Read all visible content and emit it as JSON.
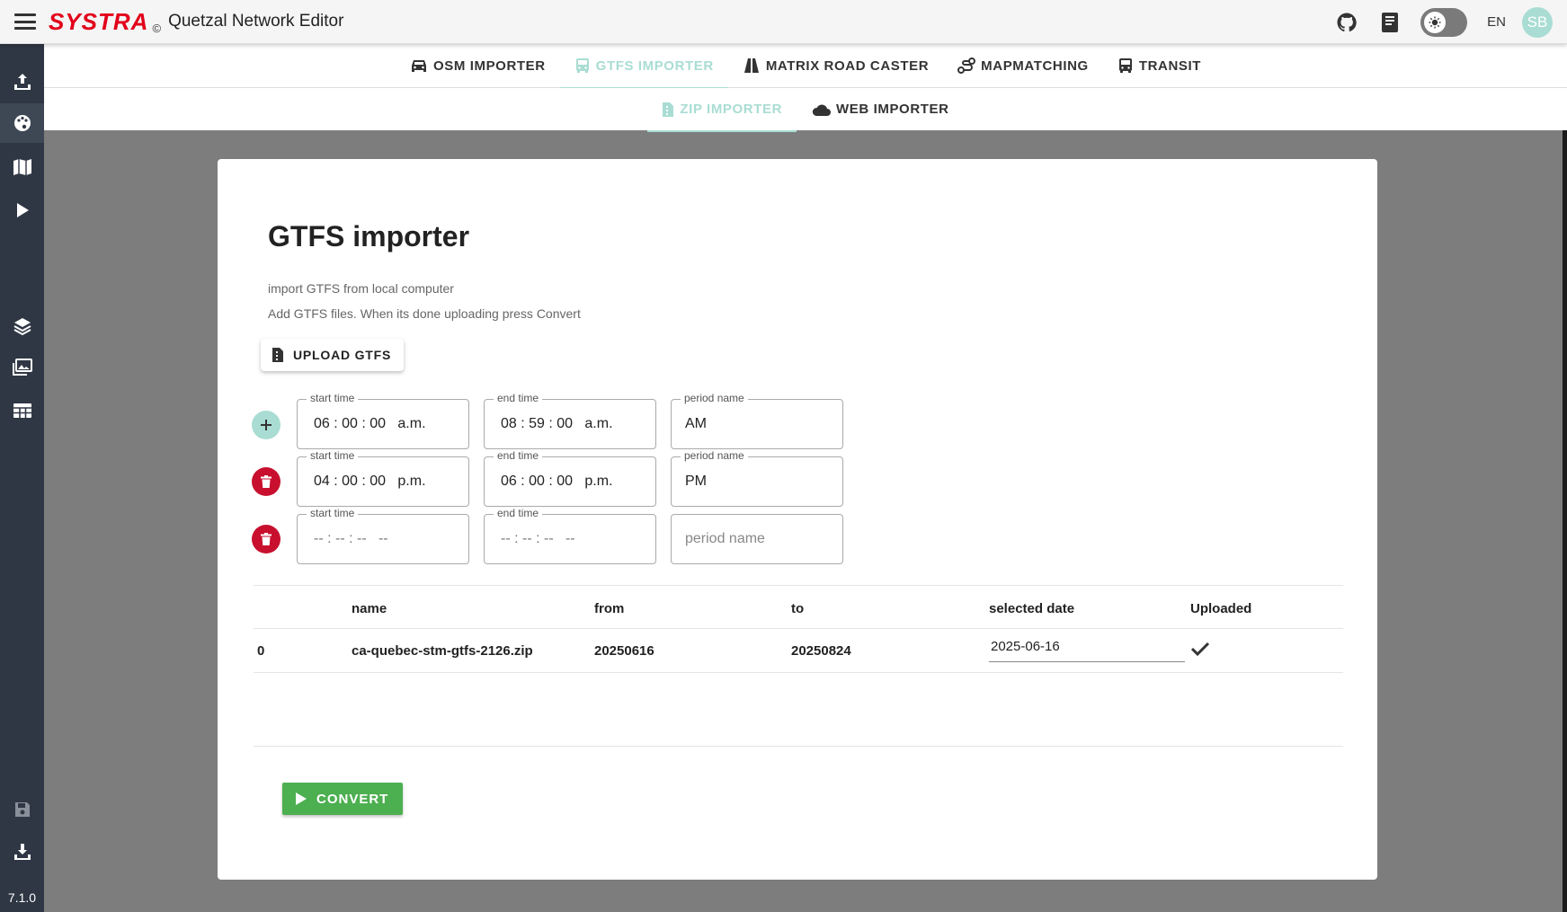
{
  "appbar": {
    "brand": "SYSTRA",
    "copyright": "©",
    "title": "Quetzal Network Editor",
    "language": "EN",
    "avatar_initials": "SB",
    "accent_color": "#a9ddd3",
    "brand_color": "#e2001a"
  },
  "sidebar": {
    "items": [
      {
        "icon": "upload-icon"
      },
      {
        "icon": "palette-icon"
      },
      {
        "icon": "map-icon"
      },
      {
        "icon": "play-icon"
      },
      {
        "icon": "layers-icon"
      },
      {
        "icon": "image-gallery-icon"
      },
      {
        "icon": "table-icon"
      },
      {
        "icon": "save-icon"
      },
      {
        "icon": "download-icon"
      }
    ],
    "version": "7.1.0"
  },
  "tabs": {
    "main": [
      {
        "label": "OSM IMPORTER",
        "icon": "car-icon"
      },
      {
        "label": "GTFS IMPORTER",
        "icon": "bus-icon",
        "active": true
      },
      {
        "label": "MATRIX ROAD CASTER",
        "icon": "road-icon"
      },
      {
        "label": "MAPMATCHING",
        "icon": "route-icon"
      },
      {
        "label": "TRANSIT",
        "icon": "transit-icon"
      }
    ],
    "sub": [
      {
        "label": "ZIP IMPORTER",
        "icon": "file-zip-icon",
        "active": true
      },
      {
        "label": "WEB IMPORTER",
        "icon": "cloud-icon"
      }
    ]
  },
  "importer": {
    "title": "GTFS importer",
    "desc1": "import GTFS from local computer",
    "desc2": "Add GTFS files. When its done uploading press Convert",
    "upload_label": "UPLOAD GTFS",
    "start_label": "start time",
    "end_label": "end time",
    "period_label": "period name",
    "period_placeholder": "period name",
    "periods": [
      {
        "start": "06 : 00 : 00   a.m.",
        "end": "08 : 59 : 00   a.m.",
        "name": "AM"
      },
      {
        "start": "04 : 00 : 00   p.m.",
        "end": "06 : 00 : 00   p.m.",
        "name": "PM"
      },
      {
        "start": "-- : -- : --   --",
        "end": "-- : -- : --   --",
        "name": ""
      }
    ],
    "table": {
      "headers": [
        "name",
        "from",
        "to",
        "selected date",
        "Uploaded"
      ],
      "rows": [
        {
          "index": "0",
          "name": "ca-quebec-stm-gtfs-2126.zip",
          "from": "20250616",
          "to": "20250824",
          "selected_date": "2025-06-16",
          "uploaded": true
        }
      ]
    },
    "convert_label": "CONVERT"
  }
}
